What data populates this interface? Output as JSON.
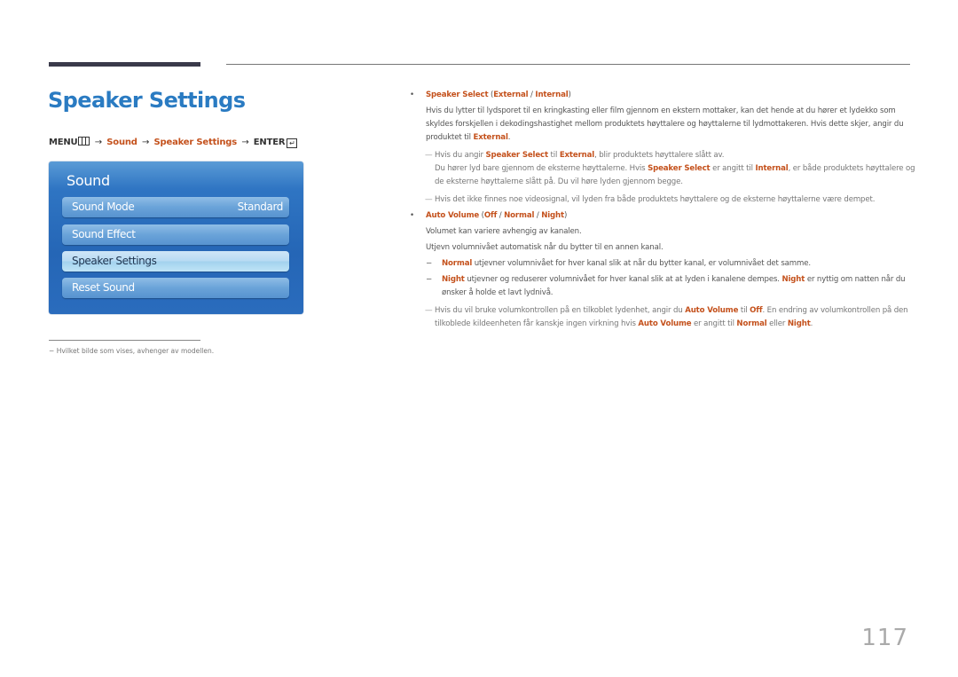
{
  "page": {
    "title": "Speaker Settings",
    "page_number": "117",
    "accent_color": "#c4511c",
    "title_color": "#2a7bc2"
  },
  "menu_path": {
    "menu": "MENU",
    "arrow": "→",
    "step1": "Sound",
    "step2": "Speaker Settings",
    "enter": "ENTER",
    "menu_icon": "menu-grid-icon",
    "enter_icon": "enter-return-icon"
  },
  "osd": {
    "title": "Sound",
    "items": [
      {
        "label": "Sound Mode",
        "value": "Standard",
        "selected": false
      },
      {
        "label": "Sound Effect",
        "value": "",
        "selected": false
      },
      {
        "label": "Speaker Settings",
        "value": "",
        "selected": true
      },
      {
        "label": "Reset Sound",
        "value": "",
        "selected": false
      }
    ]
  },
  "footnote": {
    "dash": "−",
    "text": "Hvilket bilde som vises, avhenger av modellen."
  },
  "content": {
    "speaker_select": {
      "heading": "Speaker Select",
      "opt_external": "External",
      "opt_internal": "Internal",
      "desc": "Hvis du lytter til lydsporet til en kringkasting eller film gjennom en ekstern mottaker, kan det hende at du hører et lydekko som skyldes forskjellen i dekodingshastighet mellom produktets høyttalere og høyttalerne til lydmottakeren. Hvis dette skjer, angir du produktet til",
      "desc_end": "External",
      "note1_a": "Hvis du angir",
      "note1_b": "Speaker Select",
      "note1_c": "til",
      "note1_d": "External",
      "note1_e": ", blir produktets høyttalere slått av.",
      "note1_line2_a": "Du hører lyd bare gjennom de eksterne høyttalerne. Hvis",
      "note1_line2_b": "Speaker Select",
      "note1_line2_c": "er angitt til",
      "note1_line2_d": "Internal",
      "note1_line2_e": ", er både produktets høyttalere og de eksterne høyttalerne slått på. Du vil høre lyden gjennom begge.",
      "note2": "Hvis det ikke finnes noe videosignal, vil lyden fra både produktets høyttalere og de eksterne høyttalerne være dempet."
    },
    "auto_volume": {
      "heading": "Auto Volume",
      "opt_off": "Off",
      "opt_normal": "Normal",
      "opt_night": "Night",
      "line1": "Volumet kan variere avhengig av kanalen.",
      "line2": "Utjevn volumnivået automatisk når du bytter til en annen kanal.",
      "normal_label": "Normal",
      "normal_desc": "utjevner volumnivået for hver kanal slik at når du bytter kanal, er volumnivået det samme.",
      "night_label": "Night",
      "night_desc": "utjevner og reduserer volumnivået for hver kanal slik at at lyden i kanalene dempes.",
      "night_label2": "Night",
      "night_desc2": "er nyttig om natten når du ønsker å holde et lavt lydnivå.",
      "note_a": "Hvis du vil bruke volumkontrollen på en tilkoblet lydenhet, angir du",
      "note_b": "Auto Volume",
      "note_c": "til",
      "note_d": "Off",
      "note_e": ". En endring av volumkontrollen på den tilkoblede kildeenheten får kanskje ingen virkning hvis",
      "note_f": "Auto Volume",
      "note_g": "er angitt til",
      "note_h": "Normal",
      "note_i": "eller",
      "note_j": "Night",
      "note_k": "."
    }
  }
}
